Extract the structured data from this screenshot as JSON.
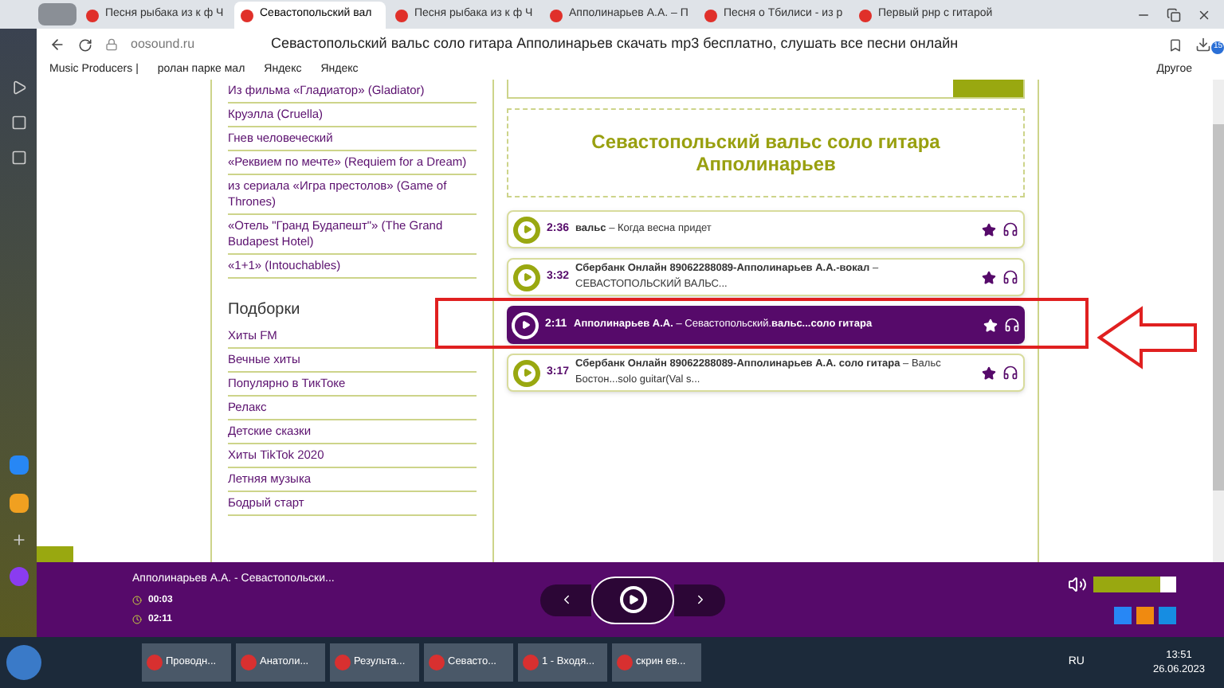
{
  "tabs": [
    {
      "label": "Песня рыбака из к ф Ч",
      "selected": false
    },
    {
      "label": "Севастопольский вал",
      "selected": true
    },
    {
      "label": "Песня рыбака из к ф Ч",
      "selected": false
    },
    {
      "label": "Апполинарьев А.А. – П",
      "selected": false
    },
    {
      "label": "Песня о Тбилиси - из р",
      "selected": false
    },
    {
      "label": "Первый рнр с гитарой",
      "selected": false
    }
  ],
  "address_bar": {
    "domain": "oosound.ru",
    "page_title": "Севастопольский вальс соло гитара Апполинарьев скачать mp3 бесплатно, слушать все песни онлайн",
    "downloads_badge": "15"
  },
  "bookmarks": [
    "Music Producers |",
    "ролан парке мал",
    "Яндекс",
    "Яндекс"
  ],
  "bookmarks_more": "Другое",
  "sidebar": {
    "films": [
      "Из фильма «Гладиатор» (Gladiator)",
      "Круэлла (Cruella)",
      "Гнев человеческий",
      "«Реквием по мечте» (Requiem for a Dream)",
      "из сериала «Игра престолов» (Game of Thrones)",
      "«Отель \"Гранд Будапешт\"» (The Grand Budapest Hotel)",
      "«1+1» (Intouchables)"
    ],
    "heading": "Подборки",
    "collections": [
      "Хиты FM",
      "Вечные хиты",
      "Популярно в ТикТоке",
      "Релакс",
      "Детские сказки",
      "Хиты TikTok 2020",
      "Летняя музыка",
      "Бодрый старт"
    ]
  },
  "song_title": "Севастопольский вальс соло гитара Апполинарьев",
  "tracks": [
    {
      "duration": "2:36",
      "title": "**вальс** – Когда весна придет",
      "selected": false
    },
    {
      "duration": "3:32",
      "title": "**Сбербанк Онлайн 89062288089-Апполинарьев А.А.-вокал** – СЕВАСТОПОЛЬСКИЙ ВАЛЬС...",
      "selected": false
    },
    {
      "duration": "2:11",
      "title": "**Апполинарьев А.А.** – Севастопольский.**вальс...соло гитара**",
      "selected": true
    },
    {
      "duration": "3:17",
      "title": "**Сбербанк Онлайн 89062288089-Апполинарьев А.А. соло гитара** – Вальс Бостон...solo guitar(Val s...",
      "selected": false
    }
  ],
  "player": {
    "now_playing": "Апполинарьев А.А. - Севастопольски...",
    "elapsed": "00:03",
    "total": "02:11",
    "volume": {
      "level": 0.8
    }
  },
  "taskbar": {
    "apps": [
      "Проводн...",
      "Анатоли...",
      "Результа...",
      "Севасто...",
      "1 - Входя...",
      "скрин ев..."
    ],
    "language": "RU",
    "time": "13:51",
    "date": "26.06.2023"
  }
}
